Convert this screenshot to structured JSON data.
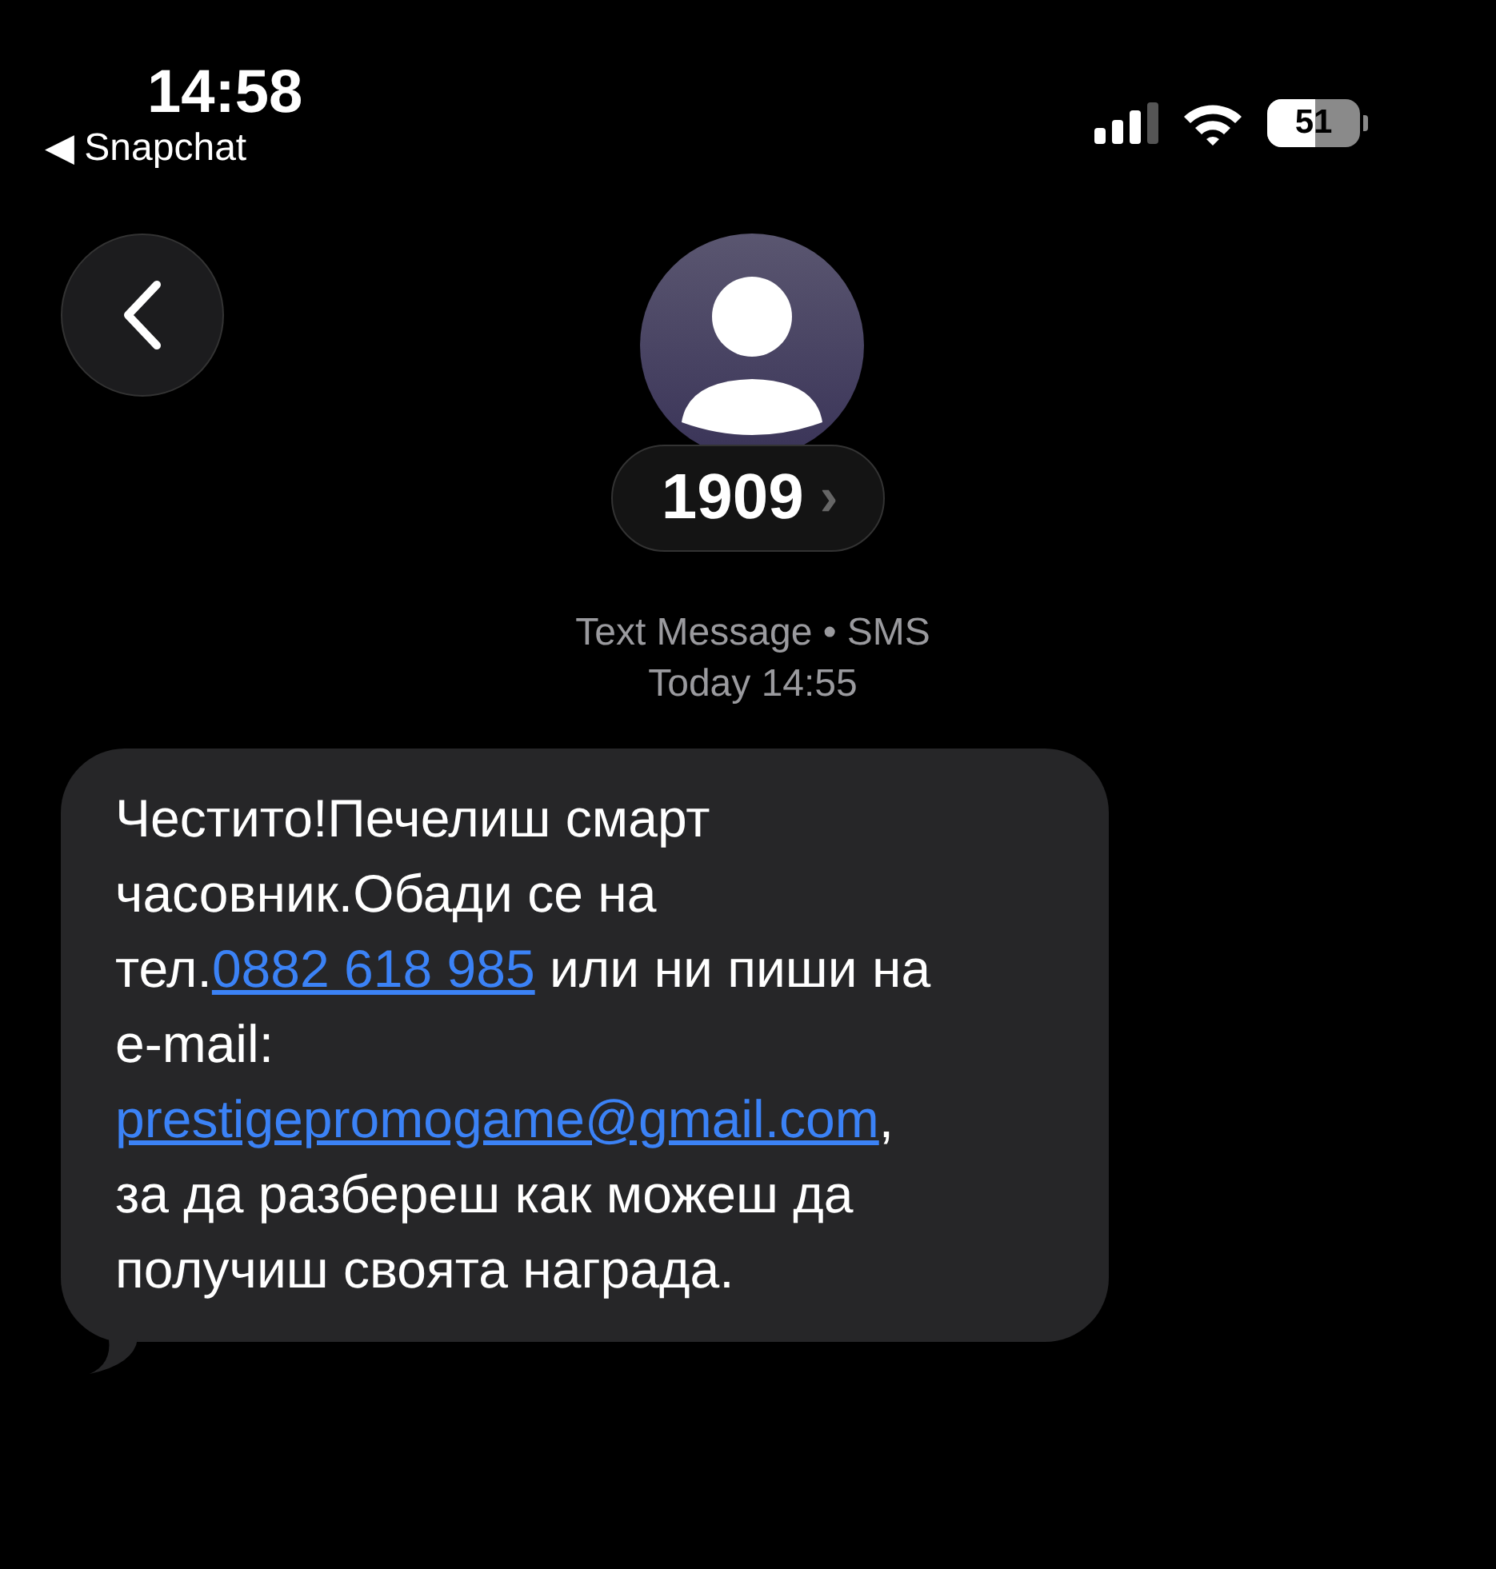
{
  "status_bar": {
    "time": "14:58",
    "back_app": "◀ Snapchat",
    "battery": "51"
  },
  "header": {
    "contact": "1909",
    "chevron": "›"
  },
  "meta": {
    "service": "Text Message • SMS",
    "timestamp": "Today 14:55"
  },
  "messages": [
    {
      "parts": [
        {
          "kind": "text",
          "text": "Честито!Печелиш смарт часовник.Обади се на тел."
        },
        {
          "kind": "link",
          "text": "0882 618 985"
        },
        {
          "kind": "text",
          "text": " или ни пиши на e-mail: "
        },
        {
          "kind": "link",
          "text": "prestigepromogame@gmail.com"
        },
        {
          "kind": "text",
          "text": ", за да разбереш как можеш да получиш своята награда."
        }
      ]
    }
  ]
}
